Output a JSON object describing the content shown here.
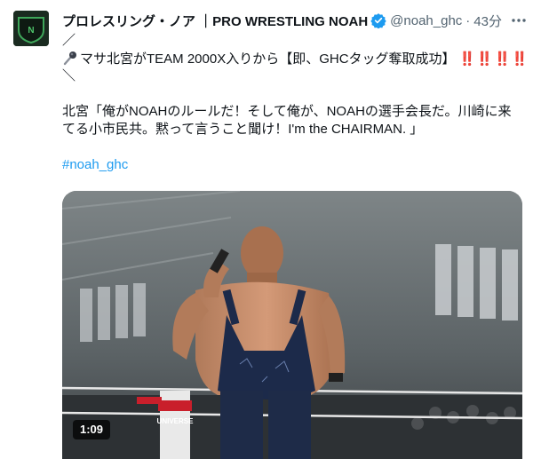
{
  "tweet": {
    "display_name": "プロレスリング・ノア ｜PRO WRESTLING NOAH",
    "handle": "@noah_ghc",
    "separator": "·",
    "time": "43分",
    "lines": {
      "slash_top": "／",
      "headline": "マサ北宮がTEAM 2000X入りから【即、GHCタッグ奪取成功】",
      "bangs": "‼️‼️‼️‼️",
      "slash_bottom": "＼",
      "quote_line1": "北宮「俺がNOAHのルールだ！そして俺が、NOAHの選手会長だ。川崎に来",
      "quote_line2": "てる小市民共。黙って言うこと聞け！I'm the CHAIRMAN. 」",
      "hashtag": "#noah_ghc"
    },
    "video": {
      "duration": "1:09",
      "ring_banner": "UNIVERSE"
    }
  },
  "colors": {
    "link": "#1d9bf0",
    "verified": "#1d9bf0",
    "secondary_text": "#536471",
    "emphasis": "#d4144d"
  },
  "icons": {
    "avatar": "noah-logo",
    "verified": "verified-badge-icon",
    "more": "more-options-icon",
    "microphone": "microphone-emoji-icon"
  }
}
